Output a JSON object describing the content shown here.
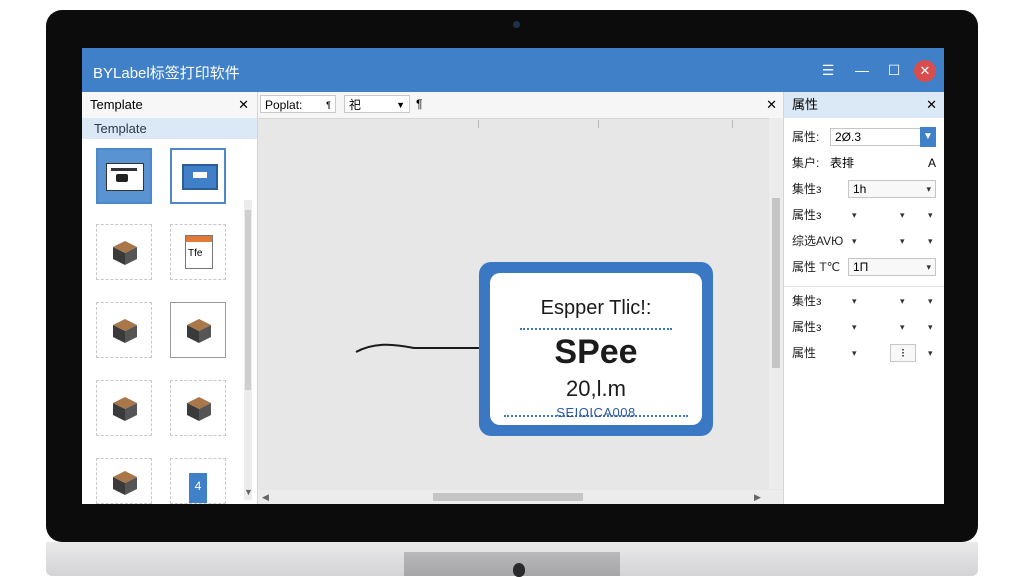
{
  "window": {
    "title": "BYLabel标签打印软件",
    "controls": [
      "☰",
      "—",
      "☐",
      "✕"
    ]
  },
  "left_panel": {
    "title": "Template",
    "section": "Template",
    "close": "✕",
    "thumbnails": [
      {
        "name": "template-label",
        "icon": "label-icon"
      },
      {
        "name": "template-box-blue",
        "icon": "blue-bin-icon"
      },
      {
        "name": "template-box",
        "icon": "box-icon"
      },
      {
        "name": "template-tag",
        "icon": "tag-icon",
        "text": "Tfe"
      },
      {
        "name": "template-box",
        "icon": "box-icon"
      },
      {
        "name": "template-box",
        "icon": "box-icon"
      },
      {
        "name": "template-box",
        "icon": "box-icon"
      },
      {
        "name": "template-box",
        "icon": "box-icon"
      },
      {
        "name": "template-box",
        "icon": "box-icon"
      },
      {
        "name": "template-bottle",
        "icon": "bottle-icon",
        "text": "4"
      }
    ]
  },
  "toolbar": {
    "field1": "Poplat:",
    "field2": "¶",
    "field3": "祀",
    "field4": "¶",
    "close": "✕"
  },
  "label": {
    "heading": "Espper Tlic!:",
    "main": "SPee",
    "value": "20,l.m",
    "code": "SEIOICA008"
  },
  "right_panel": {
    "title": "属性",
    "close": "✕",
    "rows": [
      {
        "name": "属性:",
        "value": "2Ø.3",
        "control": "blue-select"
      },
      {
        "name": "集户:",
        "value": "表排",
        "extra": "A"
      },
      {
        "name": "集性з",
        "value": "1h",
        "control": "input"
      },
      {
        "name": "属性з",
        "control": "dropdowns"
      },
      {
        "name": "综选AVЮ",
        "control": "dropdowns"
      },
      {
        "name": "属性 T℃",
        "value": "1Π",
        "control": "input"
      },
      {
        "name": "集性з",
        "control": "dropdowns"
      },
      {
        "name": "属性з",
        "control": "dropdowns"
      },
      {
        "name": "属性",
        "control": "mixed",
        "value": "⁝"
      }
    ]
  }
}
